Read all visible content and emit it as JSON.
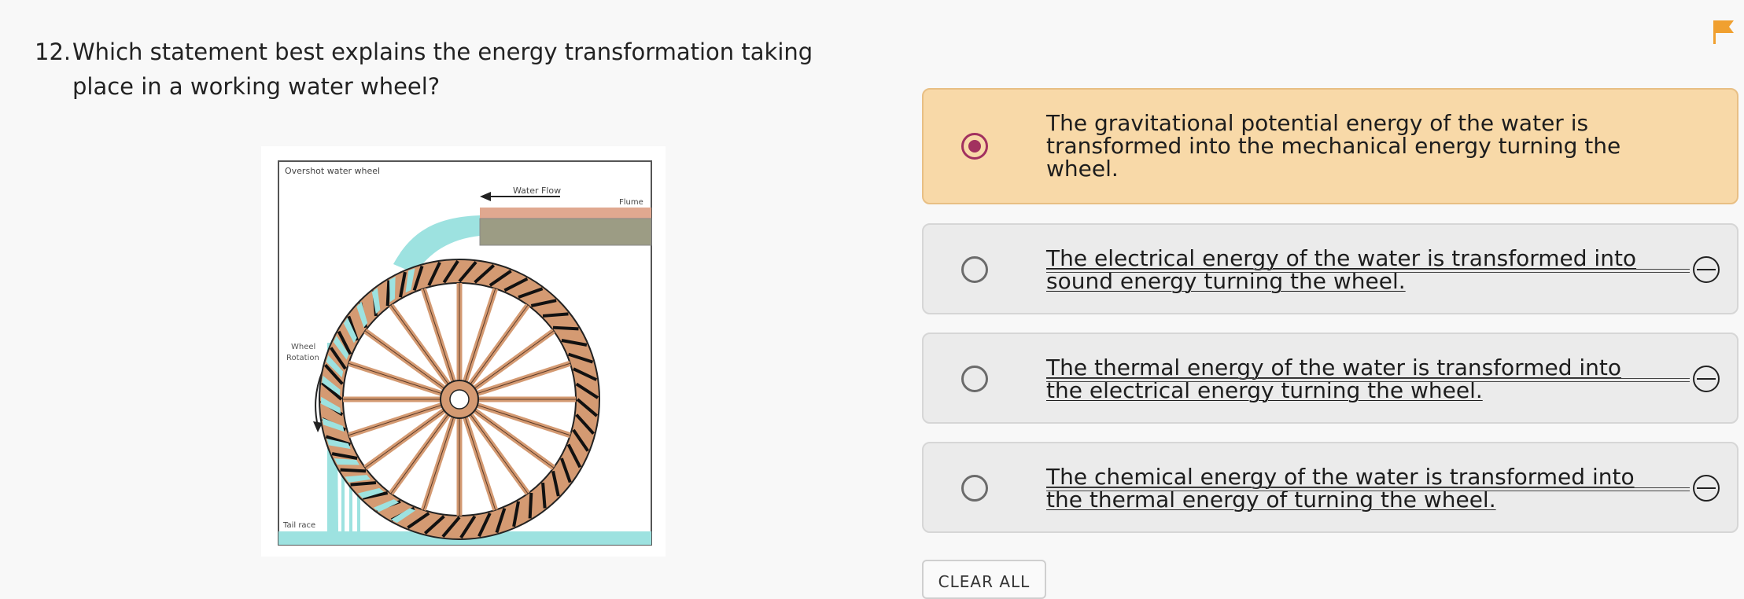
{
  "question": {
    "number": "12.",
    "text": "Which statement best explains the energy transformation taking place in a working water wheel?"
  },
  "figure": {
    "title": "Overshot water wheel",
    "water_flow_label": "Water Flow",
    "flume_label": "Flume",
    "rotation_label_line1": "Wheel",
    "rotation_label_line2": "Rotation",
    "tail_race_label": "Tail race"
  },
  "options": [
    {
      "text": "The gravitational potential energy of the water is transformed into the mechanical energy turning the wheel.",
      "state": "selected"
    },
    {
      "text": "The electrical energy of the water is transformed into sound energy turning the wheel.",
      "state": "eliminated"
    },
    {
      "text": "The thermal energy of the water is transformed into the electrical energy turning the wheel.",
      "state": "eliminated"
    },
    {
      "text": "The chemical energy of the water is transformed into the thermal energy of turning the wheel.",
      "state": "eliminated"
    }
  ],
  "clear_all_label": "CLEAR ALL",
  "colors": {
    "selected_bg": "#f8d9a8",
    "radio_accent": "#a2315f",
    "flag": "#f0a030",
    "water": "#9de2e0",
    "wheel": "#d49a72"
  },
  "icons": {
    "flag": "flag-icon",
    "eliminate": "eliminate-icon"
  }
}
